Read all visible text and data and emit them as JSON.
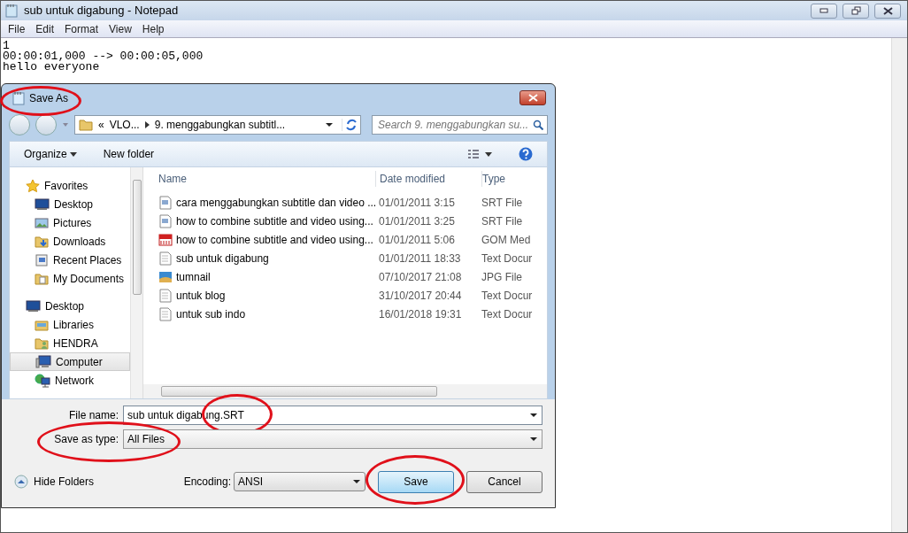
{
  "notepad": {
    "title": "sub untuk digabung - Notepad",
    "menu": [
      "File",
      "Edit",
      "Format",
      "View",
      "Help"
    ],
    "lines": [
      "1",
      "00:00:01,000 --> 00:00:05,000",
      "hello everyone"
    ]
  },
  "dialog": {
    "title": "Save As",
    "title_circled": true,
    "breadcrumb": [
      "«",
      "VLO...",
      "9. menggabungkan subtitl..."
    ],
    "search": {
      "placeholder": "Search 9. menggabungkan su..."
    },
    "toolbar": [
      "Organize",
      "New folder"
    ],
    "nav": [
      {
        "label": "Favorites",
        "kind": "star",
        "selected": false,
        "children": [
          {
            "label": "Desktop",
            "kind": "desktop",
            "selected": false
          },
          {
            "label": "Pictures",
            "kind": "pictures",
            "selected": false
          },
          {
            "label": "Downloads",
            "kind": "downloads",
            "selected": false
          },
          {
            "label": "Recent Places",
            "kind": "recent",
            "selected": false
          },
          {
            "label": "My Documents",
            "kind": "documents",
            "selected": false
          }
        ]
      },
      {
        "label": "Desktop",
        "kind": "desktop",
        "selected": false,
        "children": [
          {
            "label": "Libraries",
            "kind": "libraries",
            "selected": false
          },
          {
            "label": "HENDRA",
            "kind": "user",
            "selected": false
          },
          {
            "label": "Computer",
            "kind": "computer",
            "selected": true
          },
          {
            "label": "Network",
            "kind": "network",
            "selected": false
          }
        ]
      }
    ],
    "columns": [
      "Name",
      "Date modified",
      "Type"
    ],
    "files": [
      {
        "name": "cara menggabungkan subtitle dan video ...",
        "date": "01/01/2011 3:15",
        "type": "SRT File",
        "kind": "srt"
      },
      {
        "name": "how to combine subtitle and video using...",
        "date": "01/01/2011 3:25",
        "type": "SRT File",
        "kind": "srt"
      },
      {
        "name": "how to combine subtitle and video using...",
        "date": "01/01/2011 5:06",
        "type": "GOM Med",
        "kind": "media"
      },
      {
        "name": "sub untuk digabung",
        "date": "01/01/2011 18:33",
        "type": "Text Docur",
        "kind": "text"
      },
      {
        "name": "tumnail",
        "date": "07/10/2017 21:08",
        "type": "JPG File",
        "kind": "image"
      },
      {
        "name": "untuk blog",
        "date": "31/10/2017 20:44",
        "type": "Text Docur",
        "kind": "text"
      },
      {
        "name": "untuk sub indo",
        "date": "16/01/2018 19:31",
        "type": "Text Docur",
        "kind": "text"
      }
    ],
    "file_name": {
      "label": "File name:",
      "value": "sub untuk digabung.SRT",
      "circled": true
    },
    "save_as_type": {
      "label": "Save as type:",
      "value": "All Files",
      "circled": true
    },
    "hide_folders": "Hide Folders",
    "encoding": {
      "label": "Encoding:",
      "value": "ANSI"
    },
    "buttons": [
      {
        "label": "Save",
        "kind": "default",
        "circled": true
      },
      {
        "label": "Cancel",
        "kind": "normal",
        "circled": false
      }
    ]
  }
}
